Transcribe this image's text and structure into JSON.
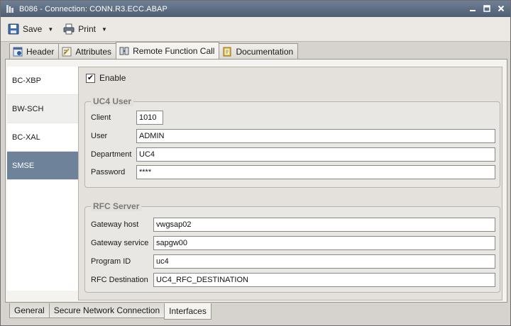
{
  "window": {
    "title": "B086 - Connection: CONN.R3.ECC.ABAP",
    "controls": [
      "minimize",
      "maximize",
      "close"
    ]
  },
  "toolbar": {
    "save_label": "Save",
    "print_label": "Print"
  },
  "tabs_top": [
    {
      "label": "Header",
      "icon": "header-icon"
    },
    {
      "label": "Attributes",
      "icon": "attributes-icon"
    },
    {
      "label": "Remote Function Call",
      "icon": "rfc-icon",
      "active": true
    },
    {
      "label": "Documentation",
      "icon": "documentation-icon"
    }
  ],
  "sidebar": {
    "items": [
      {
        "label": "BC-XBP"
      },
      {
        "label": "BW-SCH"
      },
      {
        "label": "BC-XAL"
      },
      {
        "label": "SMSE",
        "selected": true
      }
    ]
  },
  "enable": {
    "label": "Enable",
    "checked": true
  },
  "uc4_user": {
    "title": "UC4 User",
    "fields": [
      {
        "label": "Client",
        "value": "1010"
      },
      {
        "label": "User",
        "value": "ADMIN"
      },
      {
        "label": "Department",
        "value": "UC4"
      },
      {
        "label": "Password",
        "value": "****"
      }
    ]
  },
  "rfc_server": {
    "title": "RFC Server",
    "fields": [
      {
        "label": "Gateway host",
        "value": "vwgsap02"
      },
      {
        "label": "Gateway service",
        "value": "sapgw00"
      },
      {
        "label": "Program ID",
        "value": "uc4"
      },
      {
        "label": "RFC Destination",
        "value": "UC4_RFC_DESTINATION"
      }
    ]
  },
  "tabs_bottom": [
    {
      "label": "General"
    },
    {
      "label": "Secure Network Connection"
    },
    {
      "label": "Interfaces",
      "active": true
    }
  ],
  "colors": {
    "titlebar": "#5b6a7f",
    "sidebar_selected": "#6e8299"
  }
}
